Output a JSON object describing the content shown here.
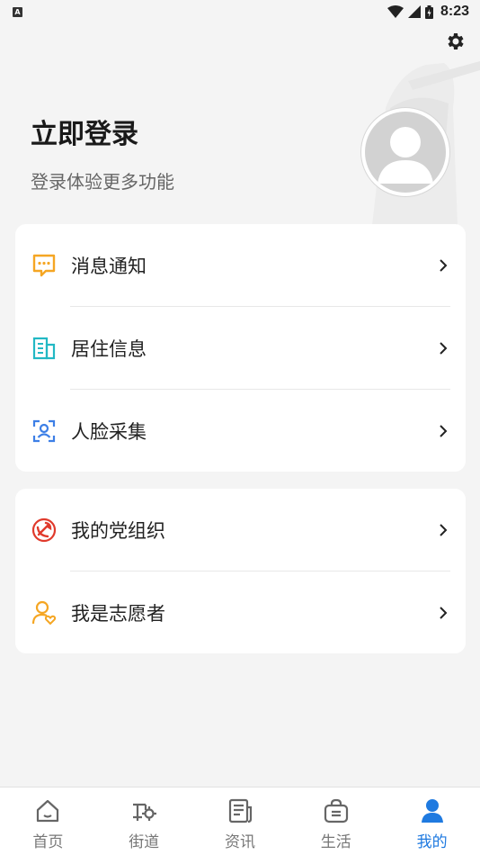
{
  "status_bar": {
    "time": "8:23",
    "badge": "A"
  },
  "header": {
    "title": "立即登录",
    "subtitle": "登录体验更多功能"
  },
  "menu_group_1": [
    {
      "label": "消息通知",
      "icon": "message-icon"
    },
    {
      "label": "居住信息",
      "icon": "building-icon"
    },
    {
      "label": "人脸采集",
      "icon": "face-scan-icon"
    }
  ],
  "menu_group_2": [
    {
      "label": "我的党组织",
      "icon": "party-emblem-icon"
    },
    {
      "label": "我是志愿者",
      "icon": "volunteer-icon"
    }
  ],
  "tabbar": {
    "items": [
      {
        "label": "首页",
        "icon": "home-icon"
      },
      {
        "label": "街道",
        "icon": "street-icon"
      },
      {
        "label": "资讯",
        "icon": "news-icon"
      },
      {
        "label": "生活",
        "icon": "life-bag-icon"
      },
      {
        "label": "我的",
        "icon": "user-icon"
      }
    ],
    "active": "我的"
  },
  "colors": {
    "accent": "#1f7ae0",
    "message": "#f5a623",
    "building": "#22b8c4",
    "face": "#3d7fe6",
    "party": "#e03a2c",
    "volunteer": "#f5a623"
  }
}
